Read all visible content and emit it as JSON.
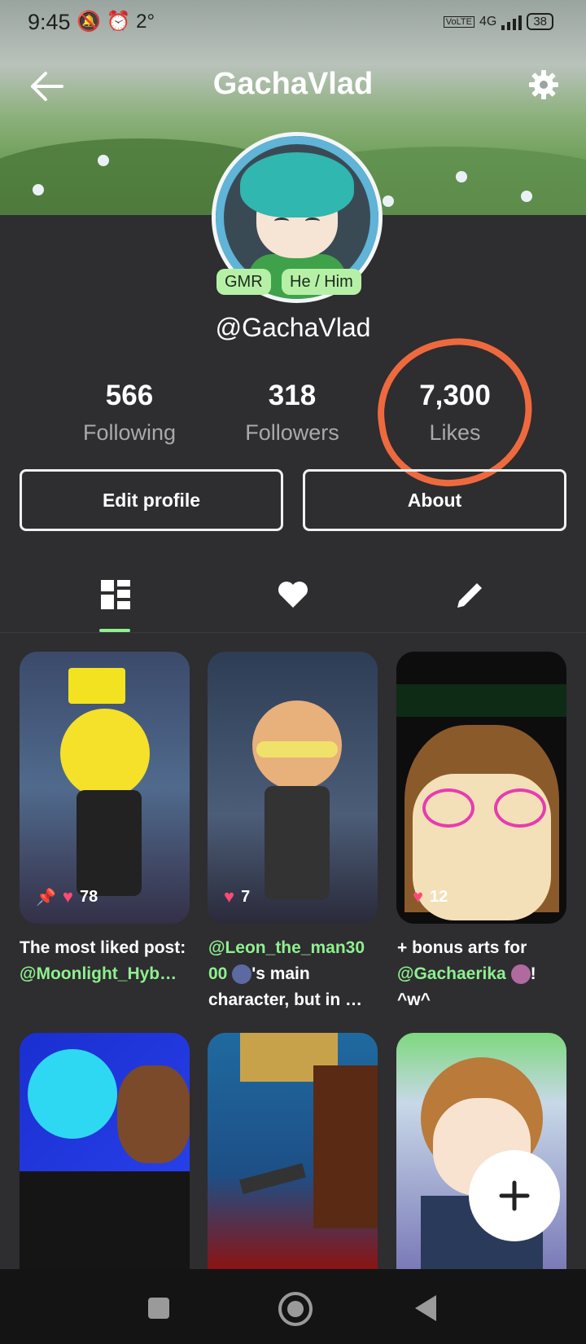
{
  "status": {
    "time": "9:45",
    "left_icons": "🔕 ⏰ 2°",
    "network": "4G",
    "lte": "VoLTE",
    "battery": "38"
  },
  "header": {
    "title": "GachaVlad"
  },
  "profile": {
    "username": "@GachaVlad",
    "badges": [
      "GMR",
      "He / Him"
    ]
  },
  "stats": [
    {
      "value": "566",
      "label": "Following"
    },
    {
      "value": "318",
      "label": "Followers"
    },
    {
      "value": "7,300",
      "label": "Likes"
    }
  ],
  "buttons": {
    "edit": "Edit profile",
    "about": "About"
  },
  "tabs": [
    "posts-icon",
    "heart-icon",
    "pencil-icon"
  ],
  "posts": [
    {
      "likes": "78",
      "pinned": true,
      "caption_1": "The most liked post: ",
      "caption_2": "@Moonlight_Hyb…",
      "caption_3": ""
    },
    {
      "likes": "7",
      "pinned": false,
      "caption_1": "@Leon_the_man30 00",
      "caption_2": "'s main character, but in …",
      "caption_3": ""
    },
    {
      "likes": "12",
      "pinned": false,
      "caption_1": "+ bonus arts for ",
      "caption_2": "@Gachaerika",
      "caption_3": "! ^w^"
    }
  ],
  "colors": {
    "accent": "#8ef08e",
    "background": "#2e2d30",
    "annotation": "#ee6a3e",
    "heart": "#ff4a78"
  }
}
